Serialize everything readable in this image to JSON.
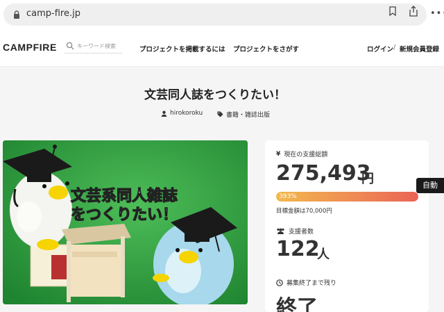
{
  "browser": {
    "url": "camp-fire.jp",
    "more_glyph": "•••"
  },
  "header": {
    "logo": "CAMPFIRE",
    "search_placeholder": "キーワード検索",
    "nav": [
      {
        "label": "プロジェクトを掲載するには"
      },
      {
        "label": "プロジェクトをさがす"
      }
    ],
    "login": "ログイン",
    "separator": "/",
    "register": "新規会員登録"
  },
  "project": {
    "title": "文芸同人誌をつくりたい！",
    "owner": "hirokoroku",
    "category": "書籍・雑誌出版",
    "image_caption": [
      "文芸系同人雑誌",
      "をつくりたい！"
    ]
  },
  "stats": {
    "total_label": "現在の支援総額",
    "total_amount": "275,493",
    "total_unit": "円",
    "progress_text": "393%",
    "progress_fraction": 1.0,
    "target_text": "目標金額は70,000円",
    "backers_label": "支援者数",
    "backers_count": "122",
    "backers_unit": "人",
    "time_label": "募集終了まで残り",
    "time_value": "終了"
  },
  "overlay": {
    "auto_label": "自動"
  },
  "colors": {
    "progress_start": "#f2b84b",
    "progress_end": "#ea6355",
    "hero_background": "#2e9b3d"
  }
}
